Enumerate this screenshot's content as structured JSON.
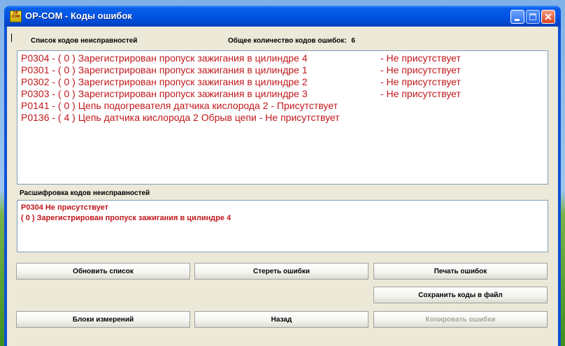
{
  "window": {
    "icon_text": "OP COM",
    "title": "OP-COM - Коды ошибок"
  },
  "codes": {
    "label": "Список кодов неисправностей",
    "total_label": "Общее количество кодов ошибок:",
    "total_value": "6",
    "items": [
      {
        "text": "P0304 - ( 0 )  Зарегистрирован пропуск зажигания в цилиндре 4",
        "status": "- Не присутствует"
      },
      {
        "text": "P0301 - ( 0 )  Зарегистрирован пропуск зажигания в цилиндре 1",
        "status": "- Не присутствует"
      },
      {
        "text": "P0302 - ( 0 )  Зарегистрирован пропуск зажигания в цилиндре 2",
        "status": "- Не присутствует"
      },
      {
        "text": "P0303 - ( 0 )  Зарегистрирован пропуск зажигания в цилиндре 3",
        "status": "- Не присутствует"
      },
      {
        "text": "P0141 - ( 0 )  Цепь подогревателя датчика кислорода 2  - Присутствует",
        "status": ""
      },
      {
        "text": "P0136 - ( 4 )  Цепь датчика кислорода 2 Обрыв цепи  - Не присутствует",
        "status": ""
      }
    ]
  },
  "decode": {
    "label": "Расшифровка кодов неисправностей",
    "lines": [
      "P0304  Не присутствует",
      "( 0 )  Зарегистрирован пропуск зажигания в цилиндре 4"
    ]
  },
  "buttons": {
    "refresh": "Обновить список",
    "erase": "Стереть ошибки",
    "print": "Печать ошибок",
    "save": "Сохранить коды в файл",
    "blocks": "Блоки измерений",
    "back": "Назад",
    "copy": "Копировать ошибки"
  },
  "colors": {
    "code_text": "#c0181c",
    "title_bar": "#0055e5",
    "dialog_bg": "#ece9d8"
  }
}
